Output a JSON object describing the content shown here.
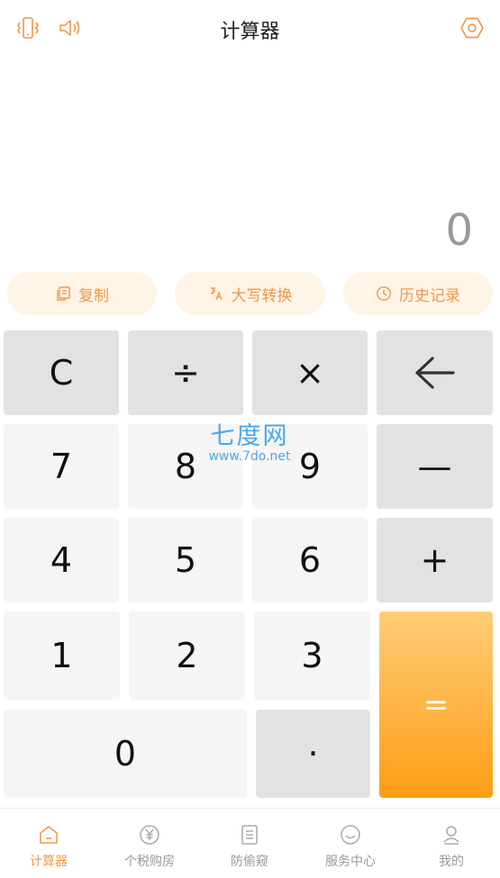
{
  "header": {
    "title": "计算器",
    "left_icons": [
      "vibrate-icon",
      "speaker-icon"
    ],
    "right_icon": "settings-hexagon-icon"
  },
  "display": {
    "value": "0"
  },
  "actions": [
    {
      "label": "复制",
      "icon": "copy-icon"
    },
    {
      "label": "大写转换",
      "icon": "translate-icon"
    },
    {
      "label": "历史记录",
      "icon": "clock-icon"
    }
  ],
  "keys": {
    "clear": "C",
    "divide": "÷",
    "multiply": "×",
    "backspace_icon": "backspace-arrow-icon",
    "seven": "7",
    "eight": "8",
    "nine": "9",
    "minus": "—",
    "four": "4",
    "five": "5",
    "six": "6",
    "plus": "+",
    "one": "1",
    "two": "2",
    "three": "3",
    "equals": "=",
    "zero": "0",
    "dot": "·"
  },
  "watermark": {
    "main": "七度网",
    "sub": "www.7do.net"
  },
  "tabs": [
    {
      "label": "计算器",
      "icon": "home-icon",
      "active": true
    },
    {
      "label": "个税购房",
      "icon": "yen-icon",
      "active": false
    },
    {
      "label": "防偷窥",
      "icon": "document-icon",
      "active": false
    },
    {
      "label": "服务中心",
      "icon": "service-icon",
      "active": false
    },
    {
      "label": "我的",
      "icon": "user-icon",
      "active": false
    }
  ],
  "colors": {
    "accent": "#f0984a",
    "pill_bg": "#fff4e6",
    "key_light": "#f5f5f5",
    "key_gray": "#e2e2e2",
    "equals_top": "#ffcd76",
    "equals_bottom": "#ff9d16"
  }
}
